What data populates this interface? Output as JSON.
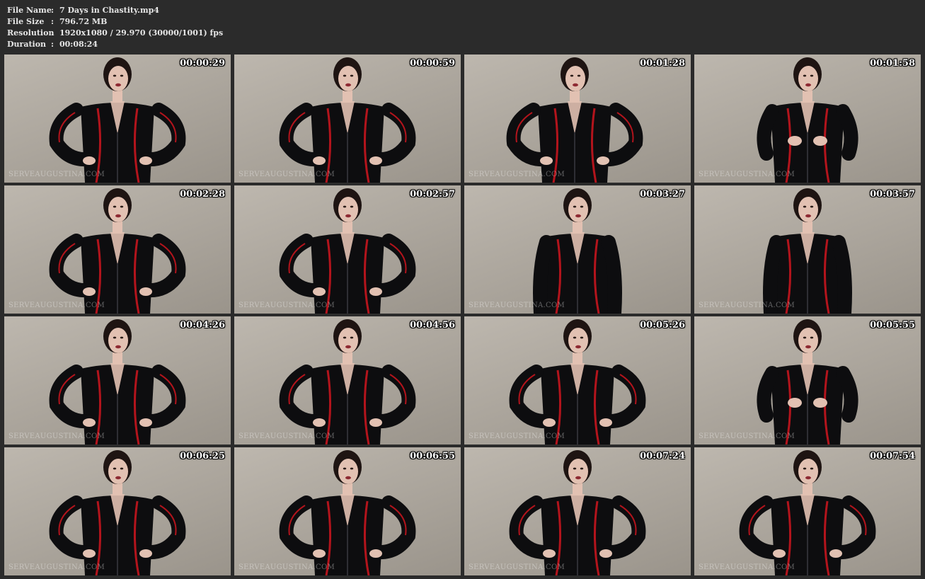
{
  "file_info": {
    "rows": [
      {
        "key": "File Name",
        "value": "7 Days in Chastity.mp4"
      },
      {
        "key": "File Size",
        "value": "796.72 MB"
      },
      {
        "key": "Resolution",
        "value": "1920x1080 / 29.970 (30000/1001) fps"
      },
      {
        "key": "Duration",
        "value": "00:08:24"
      }
    ],
    "separator": ":"
  },
  "thumbnails": [
    {
      "timestamp": "00:00:29",
      "watermark": "SERVEAUGUSTINA.COM"
    },
    {
      "timestamp": "00:00:59",
      "watermark": "SERVEAUGUSTINA.COM"
    },
    {
      "timestamp": "00:01:28",
      "watermark": "SERVEAUGUSTINA.COM"
    },
    {
      "timestamp": "00:01:58",
      "watermark": "SERVEAUGUSTINA.COM"
    },
    {
      "timestamp": "00:02:28",
      "watermark": "SERVEAUGUSTINA.COM"
    },
    {
      "timestamp": "00:02:57",
      "watermark": "SERVEAUGUSTINA.COM"
    },
    {
      "timestamp": "00:03:27",
      "watermark": "SERVEAUGUSTINA.COM"
    },
    {
      "timestamp": "00:03:57",
      "watermark": "SERVEAUGUSTINA.COM"
    },
    {
      "timestamp": "00:04:26",
      "watermark": "SERVEAUGUSTINA.COM"
    },
    {
      "timestamp": "00:04:56",
      "watermark": "SERVEAUGUSTINA.COM"
    },
    {
      "timestamp": "00:05:26",
      "watermark": "SERVEAUGUSTINA.COM"
    },
    {
      "timestamp": "00:05:55",
      "watermark": "SERVEAUGUSTINA.COM"
    },
    {
      "timestamp": "00:06:25",
      "watermark": "SERVEAUGUSTINA.COM"
    },
    {
      "timestamp": "00:06:55",
      "watermark": "SERVEAUGUSTINA.COM"
    },
    {
      "timestamp": "00:07:24",
      "watermark": "SERVEAUGUSTINA.COM"
    },
    {
      "timestamp": "00:07:54",
      "watermark": "SERVEAUGUSTINA.COM"
    }
  ],
  "colors": {
    "background": "#2b2b2b",
    "header_text": "#e6e6e6",
    "thumb_wall": "#b0aaa1",
    "suit": "#0d0d0f",
    "suit_accent": "#b3141c",
    "skin": "#e2c1b2",
    "hair": "#1e1412"
  }
}
